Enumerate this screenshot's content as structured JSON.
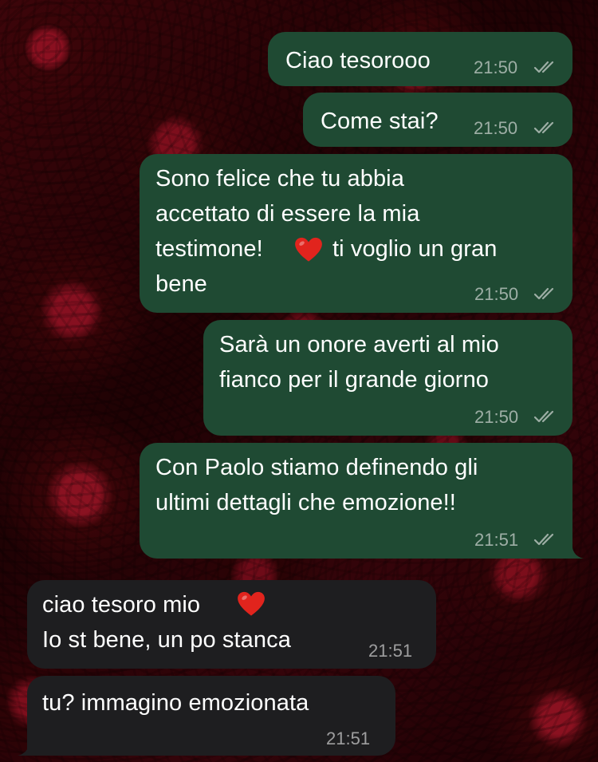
{
  "chat": {
    "messages": [
      {
        "direction": "out",
        "text": "Ciao tesorooo",
        "time": "21:50",
        "status": "read-double-check"
      },
      {
        "direction": "out",
        "text": "Come stai?",
        "time": "21:50",
        "status": "read-double-check"
      },
      {
        "direction": "out",
        "lines": [
          "Sono felice che tu abbia",
          "accettato di essere la mia",
          "testimone!",
          "ti voglio un gran",
          "bene"
        ],
        "emoji": "red-heart",
        "time": "21:50",
        "status": "read-double-check"
      },
      {
        "direction": "out",
        "lines": [
          "Sarà un onore averti al mio",
          "fianco per il grande giorno"
        ],
        "time": "21:50",
        "status": "read-double-check"
      },
      {
        "direction": "out",
        "lines": [
          "Con Paolo stiamo definendo gli",
          "ultimi dettagli che emozione!!"
        ],
        "time": "21:51",
        "status": "read-double-check"
      },
      {
        "direction": "in",
        "lines": [
          "ciao tesoro mio",
          "Io st bene, un po stanca"
        ],
        "emoji": "red-heart",
        "time": "21:51"
      },
      {
        "direction": "in",
        "text": "tu? immagino emozionata",
        "time": "21:51"
      }
    ]
  },
  "colors": {
    "outgoing_bubble": "#1f4a33",
    "incoming_bubble": "#1e1e20",
    "heart": "#e1241d"
  }
}
